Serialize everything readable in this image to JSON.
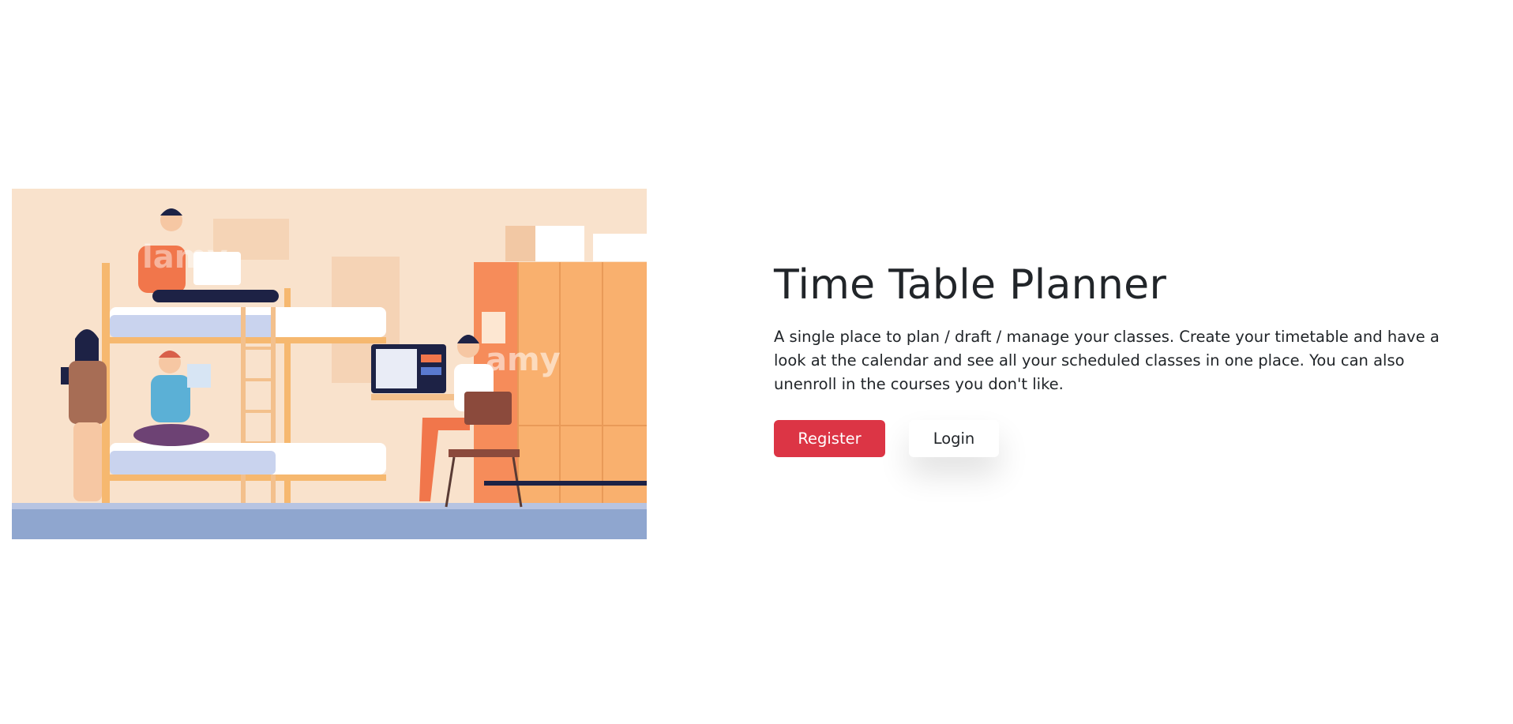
{
  "hero": {
    "image_alt": "students-dorm-room-illustration",
    "watermark": "alamy"
  },
  "main": {
    "title": "Time Table Planner",
    "description": "A single place to plan / draft / manage your classes. Create your timetable and have a look at the calendar and see all your scheduled classes in one place. You can also unenroll in the courses you don't like."
  },
  "actions": {
    "register_label": "Register",
    "login_label": "Login"
  },
  "colors": {
    "primary": "#dc3545",
    "text": "#212529",
    "background": "#ffffff"
  }
}
